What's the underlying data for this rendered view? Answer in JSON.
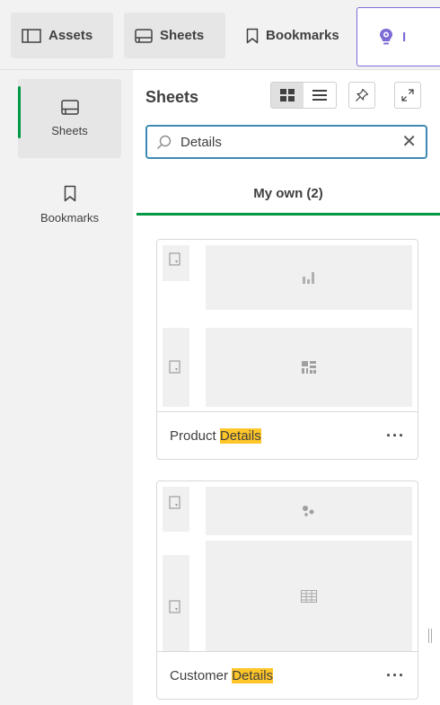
{
  "toolbar": {
    "assets_label": "Assets",
    "sheets_label": "Sheets",
    "bookmarks_label": "Bookmarks",
    "insight_partial": "I"
  },
  "rail": {
    "items": [
      {
        "label": "Sheets",
        "icon": "sheet-icon"
      },
      {
        "label": "Bookmarks",
        "icon": "bookmark-icon"
      }
    ]
  },
  "panel": {
    "title": "Sheets",
    "search": {
      "value": "Details"
    },
    "tab_label": "My own (2)"
  },
  "sheets": [
    {
      "title_prefix": "Product ",
      "title_match": "Details",
      "more": "···",
      "thumbs": [
        "bar-chart-icon",
        "kpi-grid-icon"
      ]
    },
    {
      "title_prefix": "Customer ",
      "title_match": "Details",
      "more": "···",
      "thumbs": [
        "scatter-icon",
        "table-icon"
      ]
    }
  ],
  "colors": {
    "accent_green": "#009845",
    "search_border": "#3f8ab3",
    "highlight": "#ffc629",
    "insight_purple": "#7e6bd6"
  }
}
